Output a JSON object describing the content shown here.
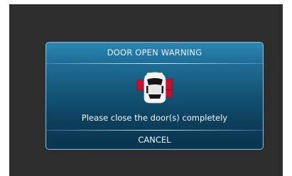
{
  "dialog": {
    "title": "DOOR OPEN WARNING",
    "icon": "car-doors-open-icon",
    "message": "Please close the door(s) completely",
    "cancel_label": "CANCEL"
  },
  "colors": {
    "screen_background": "#2d2d2d",
    "dialog_top": "#2c86b3",
    "dialog_bottom": "#0a3550",
    "door_warning": "#c8102e"
  }
}
